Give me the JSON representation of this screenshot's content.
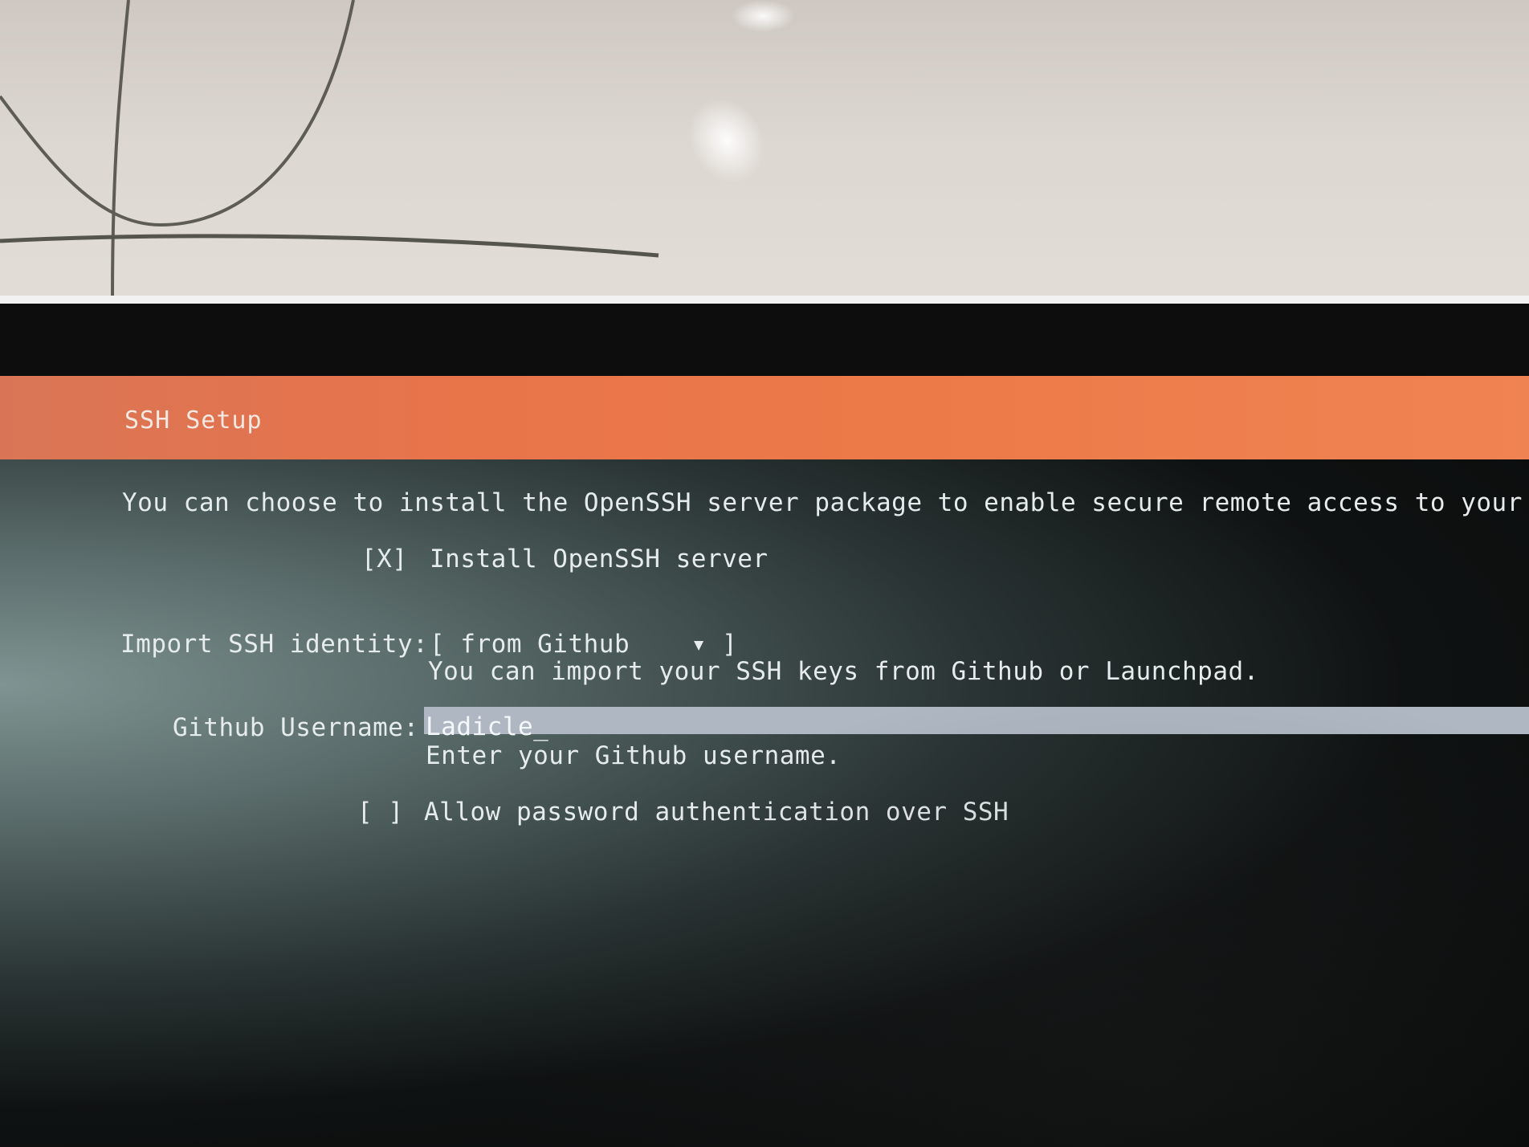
{
  "window": {
    "title": "SSH Setup"
  },
  "intro_text": "You can choose to install the OpenSSH server package to enable secure remote access to your server.",
  "install_openssh": {
    "checkbox": "[X]",
    "label": "Install OpenSSH server",
    "checked": true
  },
  "import_identity": {
    "label": "Import SSH identity:",
    "dropdown_text": "[ from Github    ▾ ]",
    "selected_value": "from Github",
    "help": "You can import your SSH keys from Github or Launchpad."
  },
  "github_username": {
    "label": "Github Username:",
    "value": "Ladicle_",
    "help": "Enter your Github username."
  },
  "allow_password": {
    "checkbox": "[ ]",
    "label": "Allow password authentication over SSH",
    "checked": false
  },
  "colors": {
    "titlebar_accent": "#e8744a",
    "terminal_text": "#e6ebec",
    "field_highlight": "#aeb7c2"
  }
}
